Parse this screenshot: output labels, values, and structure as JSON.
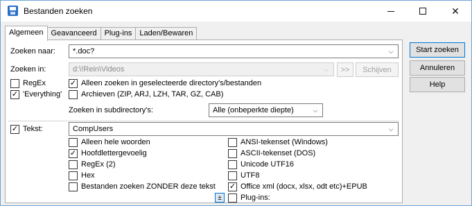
{
  "window": {
    "title": "Bestanden zoeken"
  },
  "tabs": [
    {
      "label": "Algemeen",
      "active": true
    },
    {
      "label": "Geavanceerd",
      "active": false
    },
    {
      "label": "Plug-ins",
      "active": false
    },
    {
      "label": "Laden/Bewaren",
      "active": false
    }
  ],
  "search_for": {
    "label": "Zoeken naar:",
    "value": "*.doc?"
  },
  "search_in": {
    "label": "Zoeken in:",
    "value": "d:\\!Rein\\Videos",
    "browse_label": ">>",
    "drives_label": "Schijven"
  },
  "options": {
    "regex": {
      "label": "RegEx",
      "checked": false
    },
    "everything": {
      "label": "'Everything'",
      "checked": true
    },
    "only_selected": {
      "label": "Alleen zoeken in geselecteerde directory's/bestanden",
      "checked": true
    },
    "archives": {
      "label": "Archieven (ZIP, ARJ, LZH, TAR, GZ, CAB)",
      "checked": false
    }
  },
  "subdirs": {
    "label": "Zoeken in subdirectory's:",
    "value": "Alle (onbeperkte diepte)"
  },
  "text": {
    "label": "Tekst:",
    "checked": true,
    "value": "CompUsers"
  },
  "text_options_left": [
    {
      "label": "Alleen hele woorden",
      "checked": false
    },
    {
      "label": "Hoofdlettergevoelig",
      "checked": true
    },
    {
      "label": "RegEx (2)",
      "checked": false
    },
    {
      "label": "Hex",
      "checked": false
    },
    {
      "label": "Bestanden zoeken ZONDER deze tekst",
      "checked": false
    }
  ],
  "text_options_right": [
    {
      "label": "ANSI-tekenset (Windows)",
      "checked": false
    },
    {
      "label": "ASCII-tekenset (DOS)",
      "checked": false
    },
    {
      "label": "Unicode UTF16",
      "checked": false
    },
    {
      "label": "UTF8",
      "checked": false
    },
    {
      "label": "Office xml (docx, xlsx, odt etc)+EPUB",
      "checked": true
    },
    {
      "label": "Plug-ins:",
      "checked": false
    }
  ],
  "expand_label": "±",
  "side_buttons": {
    "start": "Start zoeken",
    "cancel": "Annuleren",
    "help": "Help"
  },
  "icons": {
    "app": "save-disk-icon",
    "minimize": "minimize-icon",
    "maximize": "maximize-icon",
    "close": "close-icon",
    "dropdown": "chevron-down-icon",
    "check": "check-icon"
  },
  "colors": {
    "accent": "#0078d7",
    "app_icon": "#2c6fc7"
  }
}
